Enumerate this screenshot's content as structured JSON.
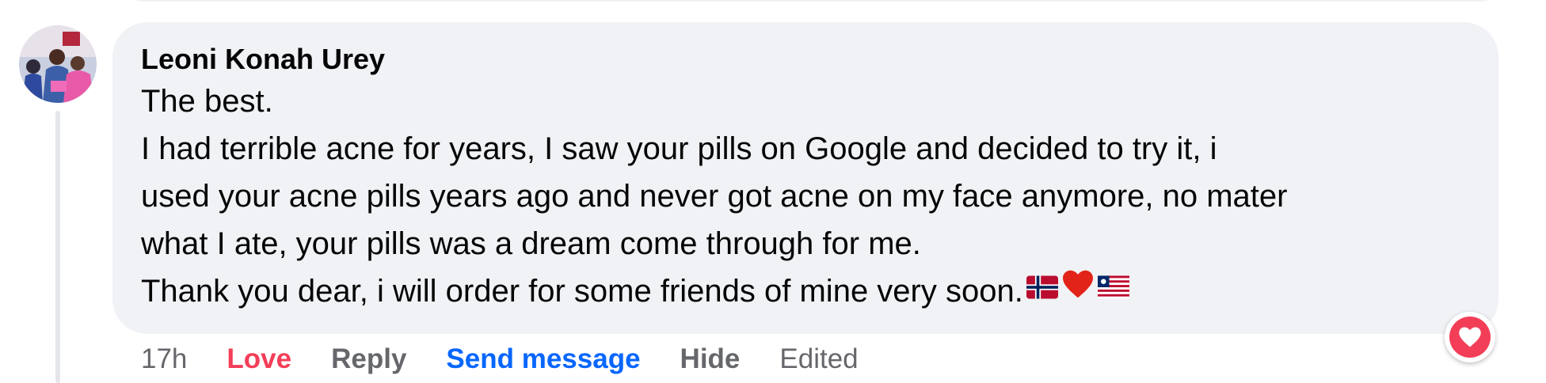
{
  "comment": {
    "author": "Leoni Konah Urey",
    "lines": [
      "The best.",
      "I had terrible acne for years, I saw your pills on Google and decided to try it, i",
      "used your acne pills years ago and never got acne on my face anymore, no mater",
      "what I ate, your pills was a dream come through for me.",
      "Thank you dear, i will order for some friends of mine very soon."
    ],
    "emojis": [
      "flag-norway-icon",
      "red-heart-icon",
      "flag-liberia-icon"
    ]
  },
  "actions": {
    "time": "17h",
    "love": "Love",
    "reply": "Reply",
    "send_message": "Send message",
    "hide": "Hide",
    "edited": "Edited"
  },
  "reaction": {
    "icon": "heart-reaction-icon",
    "color": "#f33e58"
  },
  "colors": {
    "bubble": "#f0f2f5",
    "text": "#050505",
    "muted": "#65676b",
    "link": "#0866ff",
    "love": "#f33e58"
  }
}
